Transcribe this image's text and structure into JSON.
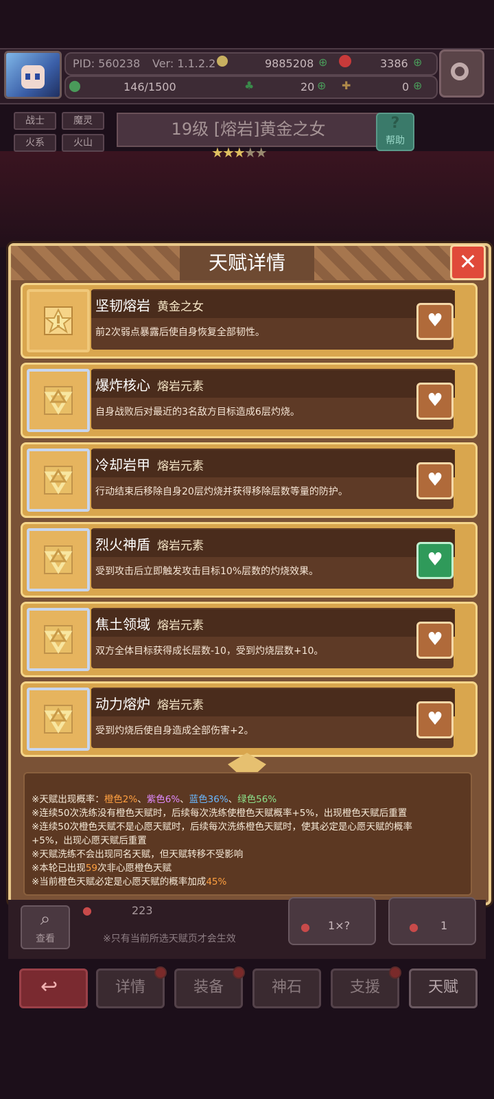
{
  "header": {
    "pid": "PID: 560238",
    "version": "Ver: 1.1.2.2",
    "gold": "9885208",
    "gems": "3386",
    "stamina": "146/1500",
    "clover": "20",
    "item_count": "0"
  },
  "hero": {
    "tags": [
      "战士",
      "魔灵",
      "火系",
      "火山"
    ],
    "title": "19级 [熔岩]黄金之女",
    "help_label": "帮助",
    "stars_filled": 3,
    "stars_total": 5
  },
  "modal": {
    "title": "天赋详情",
    "close_symbol": "✕"
  },
  "talents": [
    {
      "name": "坚韧熔岩",
      "source": "黄金之女",
      "desc": "前2次弱点暴露后使自身恢复全部韧性。",
      "icon": "star-shield-icon",
      "favorite": false
    },
    {
      "name": "爆炸核心",
      "source": "熔岩元素",
      "desc": "自身战败后对最近的3名敌方目标造成6层灼烧。",
      "icon": "triangle-emblem-icon",
      "favorite": false
    },
    {
      "name": "冷却岩甲",
      "source": "熔岩元素",
      "desc": "行动结束后移除自身20层灼烧并获得移除层数等量的防护。",
      "icon": "triangle-emblem-icon",
      "favorite": false
    },
    {
      "name": "烈火神盾",
      "source": "熔岩元素",
      "desc": "受到攻击后立即触发攻击目标10%层数的灼烧效果。",
      "icon": "triangle-emblem-icon",
      "favorite": true
    },
    {
      "name": "焦土领域",
      "source": "熔岩元素",
      "desc": "双方全体目标获得成长层数-10，受到灼烧层数+10。",
      "icon": "triangle-emblem-icon",
      "favorite": false
    },
    {
      "name": "动力熔炉",
      "source": "熔岩元素",
      "desc": "受到灼烧后使自身造成全部伤害+2。",
      "icon": "triangle-emblem-icon",
      "favorite": false
    }
  ],
  "info": {
    "rate_prefix": "※天赋出现概率：",
    "rate_orange": "橙色2%",
    "sep1": "、",
    "rate_purple": "紫色6%",
    "sep2": "、",
    "rate_blue": "蓝色36%",
    "sep3": "、",
    "rate_green": "绿色56%",
    "line2": "※连续50次洗练没有橙色天赋时，后续每次洗练使橙色天赋概率+5%，出现橙色天赋后重置",
    "line3": "※连续50次橙色天赋不是心愿天赋时，后续每次洗练橙色天赋时，使其必定是心愿天赋的概率",
    "line4": "+5%，出现心愿天赋后重置",
    "line5": "※天赋洗练不会出现同名天赋，但天赋转移不受影响",
    "line6_prefix": "※本轮已出现",
    "line6_num": "59",
    "line6_suffix": "次非心愿橙色天赋",
    "line7_prefix": "※当前橙色天赋必定是心愿天赋的概率加成",
    "line7_num": "45%"
  },
  "bottom": {
    "view_label": "查看",
    "count": "223",
    "note": "※只有当前所选天赋页才会生效",
    "auto_count": "1×?",
    "talent_count": "1"
  },
  "nav": [
    "详情",
    "装备",
    "神石",
    "支援",
    "天赋"
  ],
  "colors": {
    "accent_gold": "#f5d58a",
    "card_bg": "#d9a64e",
    "favorite_green": "#2f9a5a"
  }
}
